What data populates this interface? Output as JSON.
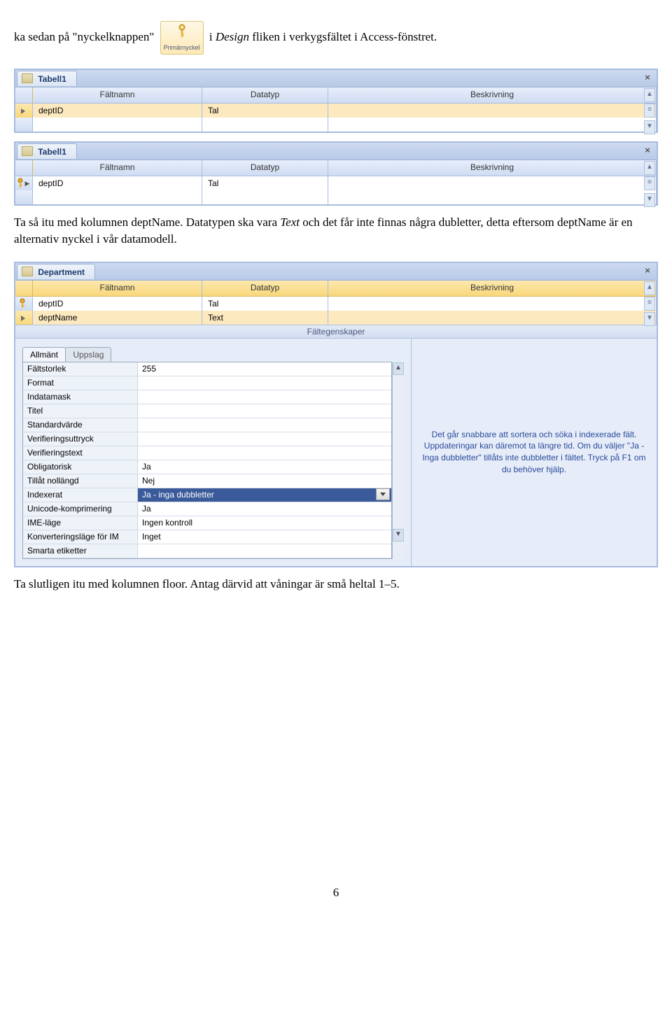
{
  "text": {
    "line1a": "ka sedan på \"nyckelknappen\"",
    "line1b": "i",
    "line1c": "Design",
    "line1d": "fliken i verkygsfältet i Access-fönstret.",
    "primarnyckel": "Primärnyckel",
    "para2a": "Ta så itu med kolumnen deptName. Datatypen ska vara",
    "para2b": "Text",
    "para2c": "och det får inte finnas några dubletter, detta eftersom deptName är en alternativ nyckel i vår datamodell.",
    "para3": "Ta slutligen itu med kolumnen floor. Antag därvid att våningar är små heltal 1–5.",
    "page_number": "6"
  },
  "panel1": {
    "tab": "Tabell1",
    "headers": {
      "field": "Fältnamn",
      "type": "Datatyp",
      "desc": "Beskrivning"
    },
    "row": {
      "field": "deptID",
      "type": "Tal"
    }
  },
  "panel2": {
    "tab": "Tabell1",
    "headers": {
      "field": "Fältnamn",
      "type": "Datatyp",
      "desc": "Beskrivning"
    },
    "row": {
      "field": "deptID",
      "type": "Tal"
    }
  },
  "panel3": {
    "tab": "Department",
    "headers": {
      "field": "Fältnamn",
      "type": "Datatyp",
      "desc": "Beskrivning"
    },
    "rows": [
      {
        "field": "deptID",
        "type": "Tal"
      },
      {
        "field": "deptName",
        "type": "Text"
      }
    ],
    "props_title": "Fältegenskaper",
    "tabs": {
      "general": "Allmänt",
      "lookup": "Uppslag"
    },
    "properties": [
      {
        "label": "Fältstorlek",
        "value": "255"
      },
      {
        "label": "Format",
        "value": ""
      },
      {
        "label": "Indatamask",
        "value": ""
      },
      {
        "label": "Titel",
        "value": ""
      },
      {
        "label": "Standardvärde",
        "value": ""
      },
      {
        "label": "Verifieringsuttryck",
        "value": ""
      },
      {
        "label": "Verifieringstext",
        "value": ""
      },
      {
        "label": "Obligatorisk",
        "value": "Ja"
      },
      {
        "label": "Tillåt nollängd",
        "value": "Nej"
      },
      {
        "label": "Indexerat",
        "value": "Ja - inga dubbletter",
        "highlight": true,
        "dropdown": true
      },
      {
        "label": "Unicode-komprimering",
        "value": "Ja"
      },
      {
        "label": "IME-läge",
        "value": "Ingen kontroll"
      },
      {
        "label": "Konverteringsläge för IM",
        "value": "Inget"
      },
      {
        "label": "Smarta etiketter",
        "value": ""
      }
    ],
    "help_text": "Det går snabbare att sortera och söka i indexerade fält. Uppdateringar kan däremot ta längre tid. Om du väljer \"Ja - Inga dubbletter\" tillåts inte dubbletter i fältet. Tryck på F1 om du behöver hjälp."
  }
}
